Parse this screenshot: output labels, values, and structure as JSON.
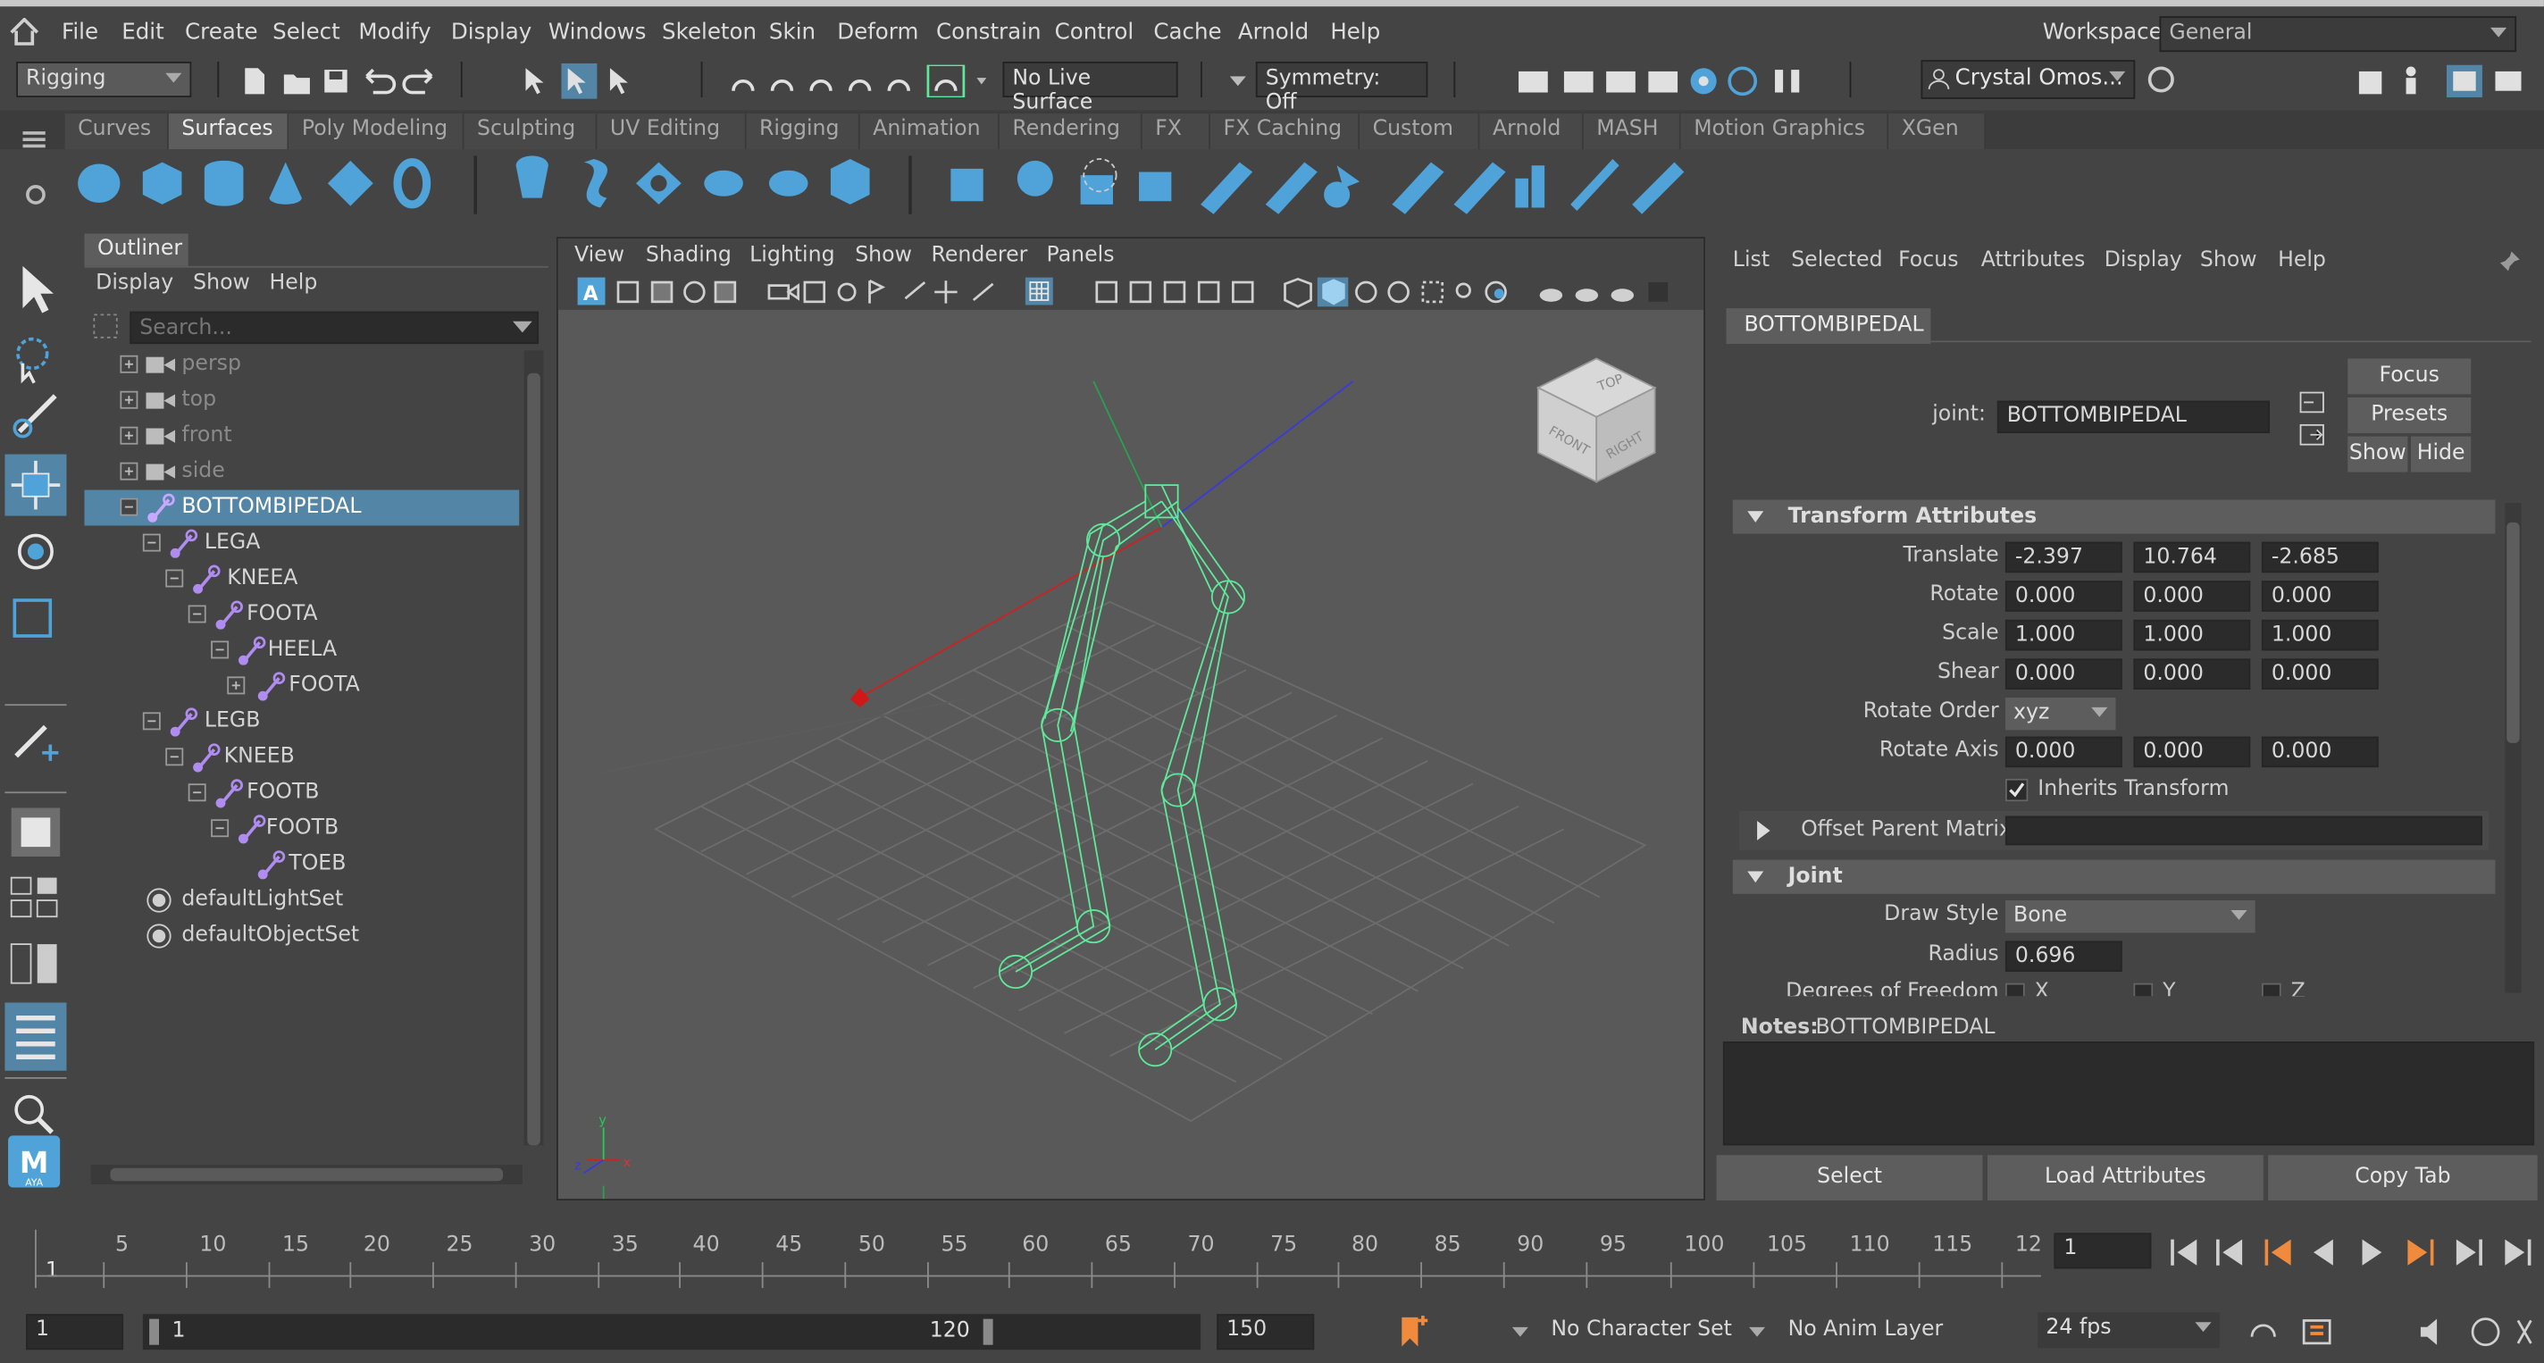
{
  "menubar": {
    "items": [
      "File",
      "Edit",
      "Create",
      "Select",
      "Modify",
      "Display",
      "Windows",
      "Skeleton",
      "Skin",
      "Deform",
      "Constrain",
      "Control",
      "Cache",
      "Arnold",
      "Help"
    ],
    "workspace_label": "Workspace:",
    "workspace_value": "General"
  },
  "statusline": {
    "menuset": "Rigging",
    "live_surface": "No Live Surface",
    "symmetry": "Symmetry: Off",
    "user": "Crystal Omos..."
  },
  "shelf_tabs": [
    "Curves",
    "Surfaces",
    "Poly Modeling",
    "Sculpting",
    "UV Editing",
    "Rigging",
    "Animation",
    "Rendering",
    "FX",
    "FX Caching",
    "Custom",
    "Arnold",
    "MASH",
    "Motion Graphics",
    "XGen"
  ],
  "shelf_active": "Surfaces",
  "outliner": {
    "title": "Outliner",
    "menus": [
      "Display",
      "Show",
      "Help"
    ],
    "search_placeholder": "Search...",
    "rows": [
      {
        "label": "persp",
        "type": "camera"
      },
      {
        "label": "top",
        "type": "camera"
      },
      {
        "label": "front",
        "type": "camera"
      },
      {
        "label": "side",
        "type": "camera"
      },
      {
        "label": "BOTTOMBIPEDAL",
        "type": "joint"
      },
      {
        "label": "LEGA",
        "type": "joint"
      },
      {
        "label": "KNEEA",
        "type": "joint"
      },
      {
        "label": "FOOTA",
        "type": "joint"
      },
      {
        "label": "HEELA",
        "type": "joint"
      },
      {
        "label": "FOOTA",
        "type": "joint"
      },
      {
        "label": "LEGB",
        "type": "joint"
      },
      {
        "label": "KNEEB",
        "type": "joint"
      },
      {
        "label": "FOOTB",
        "type": "joint"
      },
      {
        "label": "FOOTB",
        "type": "joint"
      },
      {
        "label": "TOEB",
        "type": "joint"
      },
      {
        "label": "defaultLightSet",
        "type": "set"
      },
      {
        "label": "defaultObjectSet",
        "type": "set"
      }
    ]
  },
  "viewport": {
    "menus": [
      "View",
      "Shading",
      "Lighting",
      "Show",
      "Renderer",
      "Panels"
    ],
    "viewcube": {
      "top": "TOP",
      "front": "FRONT",
      "right": "RIGHT"
    },
    "axis": {
      "x": "x",
      "y": "y",
      "z": "z"
    }
  },
  "attribute_editor": {
    "menus": [
      "List",
      "Selected",
      "Focus",
      "Attributes",
      "Display",
      "Show",
      "Help"
    ],
    "tab": "BOTTOMBIPEDAL",
    "node_type_label": "joint:",
    "node_name": "BOTTOMBIPEDAL",
    "buttons": {
      "focus": "Focus",
      "presets": "Presets",
      "show": "Show",
      "hide": "Hide"
    },
    "transform_section": "Transform Attributes",
    "translate_label": "Translate",
    "translate": [
      "-2.397",
      "10.764",
      "-2.685"
    ],
    "rotate_label": "Rotate",
    "rotate": [
      "0.000",
      "0.000",
      "0.000"
    ],
    "scale_label": "Scale",
    "scale": [
      "1.000",
      "1.000",
      "1.000"
    ],
    "shear_label": "Shear",
    "shear": [
      "0.000",
      "0.000",
      "0.000"
    ],
    "rotate_order_label": "Rotate Order",
    "rotate_order": "xyz",
    "rotate_axis_label": "Rotate Axis",
    "rotate_axis": [
      "0.000",
      "0.000",
      "0.000"
    ],
    "inherits_transform": "Inherits Transform",
    "offset_parent_matrix": "Offset Parent Matrix",
    "joint_section": "Joint",
    "draw_style_label": "Draw Style",
    "draw_style": "Bone",
    "radius_label": "Radius",
    "radius": "0.696",
    "dof_label": "Degrees of Freedom",
    "dof_x": "X",
    "dof_y": "Y",
    "dof_z": "Z",
    "notes_label": "Notes:",
    "notes_node": "BOTTOMBIPEDAL",
    "bottom_buttons": [
      "Select",
      "Load Attributes",
      "Copy Tab"
    ]
  },
  "timeline": {
    "labels": [
      "5",
      "10",
      "15",
      "20",
      "25",
      "30",
      "35",
      "40",
      "45",
      "50",
      "55",
      "60",
      "65",
      "70",
      "75",
      "80",
      "85",
      "90",
      "95",
      "100",
      "105",
      "110",
      "115",
      "12"
    ],
    "current_frame_marker": "1",
    "current_frame_field": "1"
  },
  "range": {
    "start": "1",
    "playback_start": "1",
    "playback_end": "120",
    "end": "150",
    "character_set": "No Character Set",
    "anim_layer": "No Anim Layer",
    "fps": "24 fps"
  },
  "colors": {
    "selection": "#5285a6",
    "accent": "#4fa3d9",
    "skeleton": "#5fe89a"
  }
}
